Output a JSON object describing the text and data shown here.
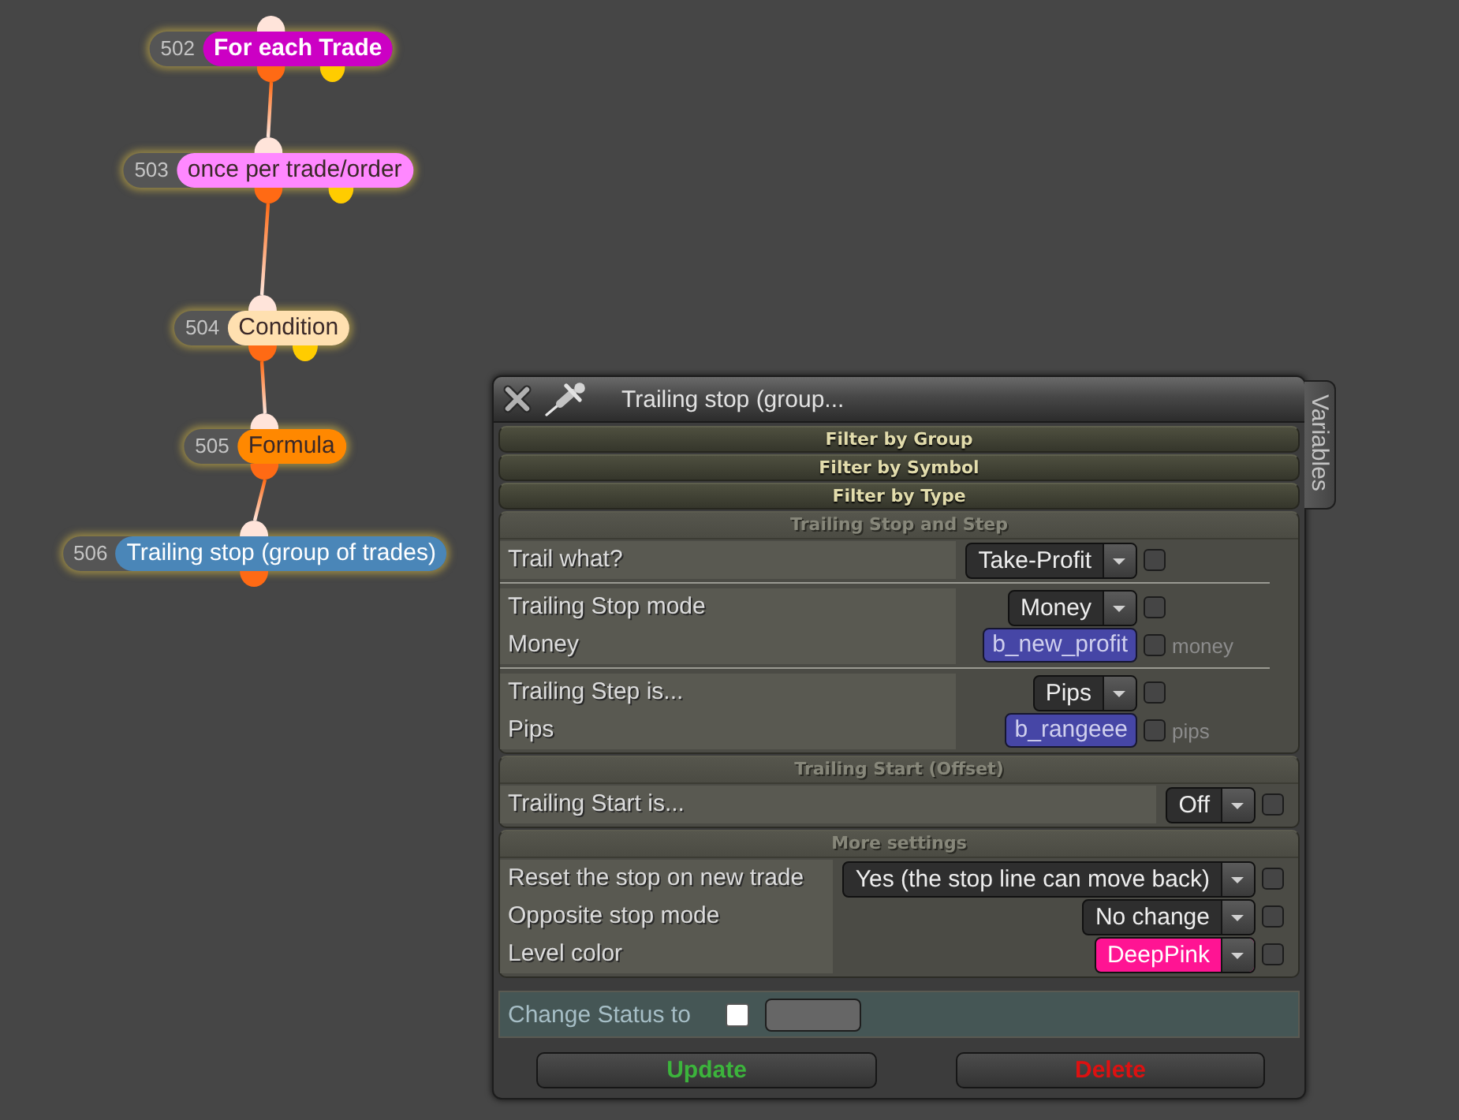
{
  "nodes": [
    {
      "number": "502",
      "label": "For each Trade",
      "kind": "loop",
      "color": "#cc00c4"
    },
    {
      "number": "503",
      "label": "once per trade/order",
      "kind": "condition",
      "color": "#ff88ff"
    },
    {
      "number": "504",
      "label": "Condition",
      "kind": "condition",
      "color": "#ffe0b0"
    },
    {
      "number": "505",
      "label": "Formula",
      "kind": "action",
      "color": "#ff8800"
    },
    {
      "number": "506",
      "label": "Trailing stop (group of trades)",
      "kind": "action",
      "color": "#4a86b8"
    }
  ],
  "dialog": {
    "title": "Trailing stop (group...",
    "side_tab": "Variables",
    "sections": [
      {
        "title": "Filter by Group",
        "expanded": false
      },
      {
        "title": "Filter by Symbol",
        "expanded": false
      },
      {
        "title": "Filter by Type",
        "expanded": false
      },
      {
        "title": "Trailing Stop and Step",
        "expanded": true,
        "rows": [
          {
            "kind": "select",
            "label": "Trail what?",
            "value": "Take-Profit",
            "checked": false
          },
          {
            "kind": "divider"
          },
          {
            "kind": "select",
            "label": "Trailing Stop mode",
            "value": "Money",
            "checked": false
          },
          {
            "kind": "variable",
            "label": "Money",
            "value": "b_new_profit",
            "checked": false,
            "unit": "money"
          },
          {
            "kind": "divider"
          },
          {
            "kind": "select",
            "label": "Trailing Step is...",
            "value": "Pips",
            "checked": false
          },
          {
            "kind": "variable",
            "label": "Pips",
            "value": "b_rangeee",
            "checked": false,
            "unit": "pips"
          }
        ]
      },
      {
        "title": "Trailing Start (Offset)",
        "expanded": true,
        "rows": [
          {
            "kind": "select",
            "label": "Trailing Start is...",
            "value": "Off",
            "checked": false
          }
        ]
      },
      {
        "title": "More settings",
        "expanded": true,
        "rows": [
          {
            "kind": "select",
            "label": "Reset the stop on new trade",
            "value": "Yes (the stop line can move back)",
            "checked": false
          },
          {
            "kind": "select",
            "label": "Opposite stop mode",
            "value": "No change",
            "checked": false
          },
          {
            "kind": "select",
            "label": "Level color",
            "value": "DeepPink",
            "color": "#ff1493",
            "checked": false
          }
        ]
      }
    ],
    "status": {
      "label": "Change Status to",
      "checked": false
    },
    "buttons": [
      {
        "label": "Update",
        "color": "#3cb43c"
      },
      {
        "label": "Delete",
        "color": "#dd1111"
      }
    ]
  }
}
